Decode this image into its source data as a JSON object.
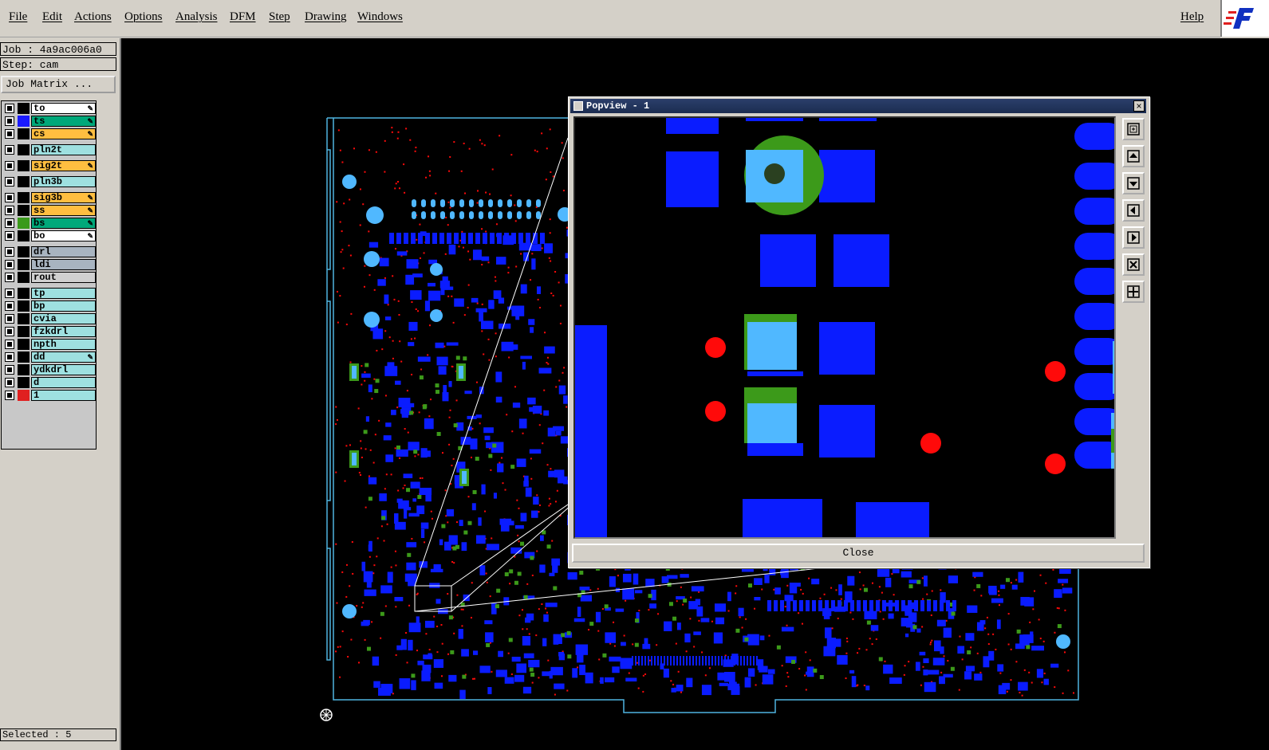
{
  "menu": {
    "items": [
      "File",
      "Edit",
      "Actions",
      "Options",
      "Analysis",
      "DFM",
      "Step",
      "Drawing",
      "Windows"
    ],
    "help": "Help"
  },
  "panel": {
    "job": "Job : 4a9ac006a0",
    "step": "Step: cam",
    "job_matrix": "Job Matrix ...",
    "status": "Selected : 5"
  },
  "layers": [
    {
      "name": "to",
      "color": "#ffffff",
      "swatch": "#000000",
      "hand": true
    },
    {
      "name": "ts",
      "color": "#00a87a",
      "swatch": "#1a1aff",
      "hand": true
    },
    {
      "name": "cs",
      "color": "#ffbe40",
      "swatch": "#000000",
      "hand": true
    },
    {
      "name": "pln2t",
      "color": "#9ee0e0",
      "swatch": "#000000",
      "hand": false
    },
    {
      "name": "sig2t",
      "color": "#ffbe40",
      "swatch": "#000000",
      "hand": true
    },
    {
      "name": "pln3b",
      "color": "#9ee0e0",
      "swatch": "#000000",
      "hand": false
    },
    {
      "name": "sig3b",
      "color": "#ffbe40",
      "swatch": "#000000",
      "hand": true
    },
    {
      "name": "ss",
      "color": "#ffbe40",
      "swatch": "#000000",
      "hand": true
    },
    {
      "name": "bs",
      "color": "#00a87a",
      "swatch": "#3a9a1a",
      "hand": true
    },
    {
      "name": "bo",
      "color": "#ffffff",
      "swatch": "#000000",
      "hand": true
    },
    {
      "name": "drl",
      "color": "#a8b4c0",
      "swatch": "#000000",
      "hand": false
    },
    {
      "name": "ldi",
      "color": "#a8b4c0",
      "swatch": "#000000",
      "hand": false
    },
    {
      "name": "rout",
      "color": "#d0d0d0",
      "swatch": "#000000",
      "hand": false
    },
    {
      "name": "tp",
      "color": "#9ee0e0",
      "swatch": "#000000",
      "hand": false
    },
    {
      "name": "bp",
      "color": "#9ee0e0",
      "swatch": "#000000",
      "hand": false
    },
    {
      "name": "cvia",
      "color": "#9ee0e0",
      "swatch": "#000000",
      "hand": false
    },
    {
      "name": "fzkdrl",
      "color": "#9ee0e0",
      "swatch": "#000000",
      "hand": false
    },
    {
      "name": "npth",
      "color": "#9ee0e0",
      "swatch": "#000000",
      "hand": false
    },
    {
      "name": "dd",
      "color": "#9ee0e0",
      "swatch": "#000000",
      "hand": true
    },
    {
      "name": "ydkdrl",
      "color": "#9ee0e0",
      "swatch": "#000000",
      "hand": false
    },
    {
      "name": "d",
      "color": "#9ee0e0",
      "swatch": "#000000",
      "hand": false
    },
    {
      "name": "1",
      "color": "#9ee0e0",
      "swatch": "#e02020",
      "hand": false
    }
  ],
  "popview": {
    "title": "Popview - 1",
    "close_label": "Close",
    "close_x": "×"
  },
  "colors": {
    "pad": "#0a1cff",
    "smd_light": "#50b8ff",
    "green": "#3c9a1a",
    "drill": "#ff0a0a",
    "outline": "#4fb4e0"
  }
}
